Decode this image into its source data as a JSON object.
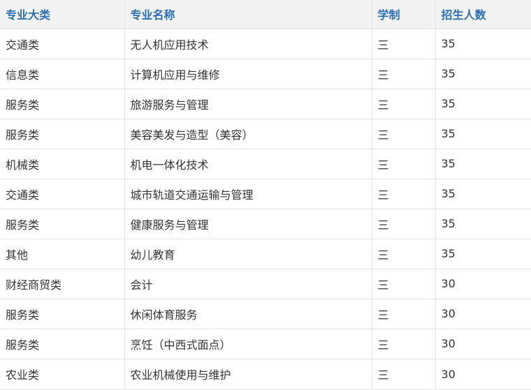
{
  "table": {
    "headers": [
      "专业大类",
      "专业名称",
      "学制",
      "招生人数"
    ],
    "rows": [
      [
        "交通类",
        "无人机应用技术",
        "三",
        "35"
      ],
      [
        "信息类",
        "计算机应用与维修",
        "三",
        "35"
      ],
      [
        "服务类",
        "旅游服务与管理",
        "三",
        "35"
      ],
      [
        "服务类",
        "美容美发与造型（美容）",
        "三",
        "35"
      ],
      [
        "机械类",
        "机电一体化技术",
        "三",
        "35"
      ],
      [
        "交通类",
        "城市轨道交通运输与管理",
        "三",
        "35"
      ],
      [
        "服务类",
        "健康服务与管理",
        "三",
        "35"
      ],
      [
        "其他",
        "幼儿教育",
        "三",
        "35"
      ],
      [
        "财经商贸类",
        "会计",
        "三",
        "30"
      ],
      [
        "服务类",
        "休闲体育服务",
        "三",
        "30"
      ],
      [
        "服务类",
        "烹饪（中西式面点）",
        "三",
        "30"
      ],
      [
        "农业类",
        "农业机械使用与维护",
        "三",
        "30"
      ]
    ]
  },
  "colors": {
    "header_text": "#2a6fb5",
    "header_bg": "#f2f2f2",
    "body_text": "#333333",
    "grid_line": "#e2e2e2"
  }
}
